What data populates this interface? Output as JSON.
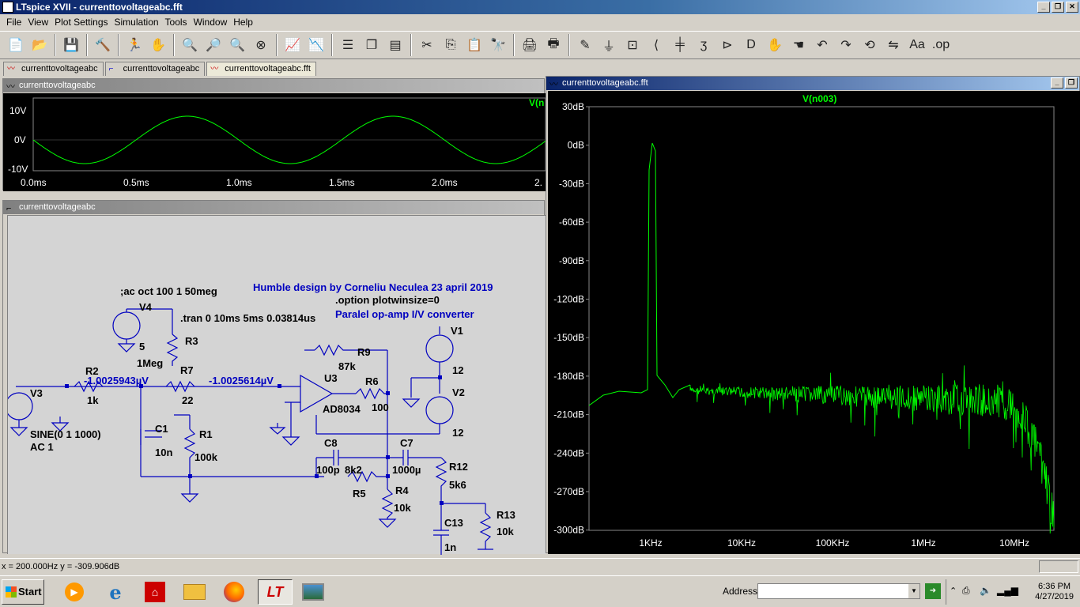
{
  "window": {
    "title": "LTspice XVII - currenttovoltageabc.fft"
  },
  "menu": [
    "File",
    "View",
    "Plot Settings",
    "Simulation",
    "Tools",
    "Window",
    "Help"
  ],
  "tabs": [
    {
      "label": "currenttovoltageabc"
    },
    {
      "label": "currenttovoltageabc"
    },
    {
      "label": "currenttovoltageabc.fft"
    }
  ],
  "wave_panel": {
    "title": "currenttovoltageabc",
    "trace_label": "V(n",
    "y_ticks": [
      "10V",
      "0V",
      "-10V"
    ],
    "x_ticks": [
      "0.0ms",
      "0.5ms",
      "1.0ms",
      "1.5ms",
      "2.0ms",
      "2."
    ]
  },
  "schematic_panel": {
    "title": "currenttovoltageabc",
    "texts": {
      "humble": "Humble design by Corneliu Neculea 23 april 2019",
      "option": ".option plotwinsize=0",
      "paralel": "Paralel op-amp I/V converter",
      "ac": ";ac oct 100 1 50meg",
      "tran": ".tran 0 10ms 5ms 0.03814us",
      "v4": "V4",
      "v4val": "5",
      "r3": "R3",
      "r3val": "1Meg",
      "r7": "R7",
      "r7val": "22",
      "r2": "R2",
      "r2val": "1k",
      "v3": "V3",
      "v3val": "SINE(0 1 1000)",
      "v3ac": "AC 1",
      "probe1": "-1.0025943µV",
      "probe2": "-1.0025614µV",
      "c1": "C1",
      "c1val": "10n",
      "r1": "R1",
      "r1val": "100k",
      "r9": "R9",
      "r9val": "87k",
      "u3": "U3",
      "u3val": "AD8034",
      "r6": "R6",
      "r6val": "100",
      "v1": "V1",
      "v1val": "12",
      "v2": "V2",
      "v2val": "12",
      "c8": "C8",
      "c8val": "100p",
      "r5": "R5",
      "r5val": "8k2",
      "c7": "C7",
      "c7val": "1000µ",
      "r12": "R12",
      "r12val": "5k6",
      "r4": "R4",
      "r4val": "10k",
      "c13": "C13",
      "c13val": "1n",
      "r13": "R13",
      "r13val": "10k"
    }
  },
  "fft_panel": {
    "title": "currenttovoltageabc.fft",
    "trace_label": "V(n003)",
    "y_ticks": [
      "30dB",
      "0dB",
      "-30dB",
      "-60dB",
      "-90dB",
      "-120dB",
      "-150dB",
      "-180dB",
      "-210dB",
      "-240dB",
      "-270dB",
      "-300dB"
    ],
    "x_ticks": [
      "1KHz",
      "10KHz",
      "100KHz",
      "1MHz",
      "10MHz"
    ]
  },
  "colors": {
    "trace": "#00ff00",
    "schematic_wire": "#0000c0",
    "schematic_text": "#0000c0"
  },
  "status": {
    "readout": "x = 200.000Hz   y = -309.906dB"
  },
  "taskbar": {
    "start": "Start",
    "address_label": "Address",
    "time": "6:36 PM",
    "date": "4/27/2019"
  }
}
